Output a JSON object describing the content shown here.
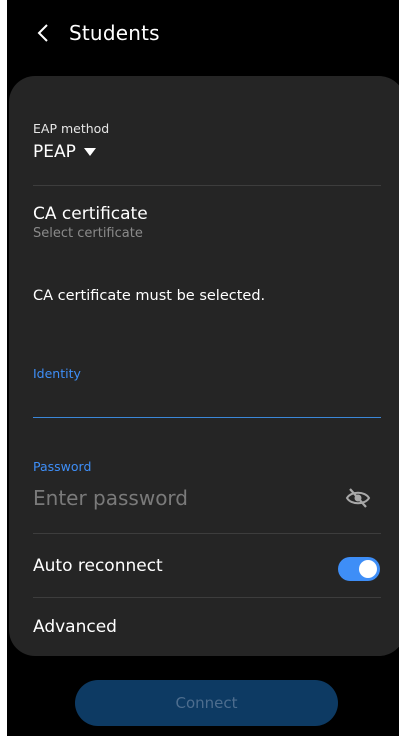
{
  "header": {
    "title": "Students"
  },
  "eap": {
    "label": "EAP method",
    "value": "PEAP"
  },
  "ca_certificate": {
    "title": "CA certificate",
    "subtitle": "Select certificate"
  },
  "warning": {
    "text": "CA certificate must be selected."
  },
  "identity": {
    "label": "Identity",
    "value": ""
  },
  "password": {
    "label": "Password",
    "placeholder": "Enter password",
    "toggle_icon": "eye-off-icon"
  },
  "auto_reconnect": {
    "label": "Auto reconnect",
    "enabled": true
  },
  "advanced": {
    "label": "Advanced"
  },
  "connect": {
    "label": "Connect"
  },
  "colors": {
    "accent": "#3e8ef7",
    "card_bg": "#252525",
    "screen_bg": "#000000",
    "connect_bg": "#0d3a63"
  }
}
